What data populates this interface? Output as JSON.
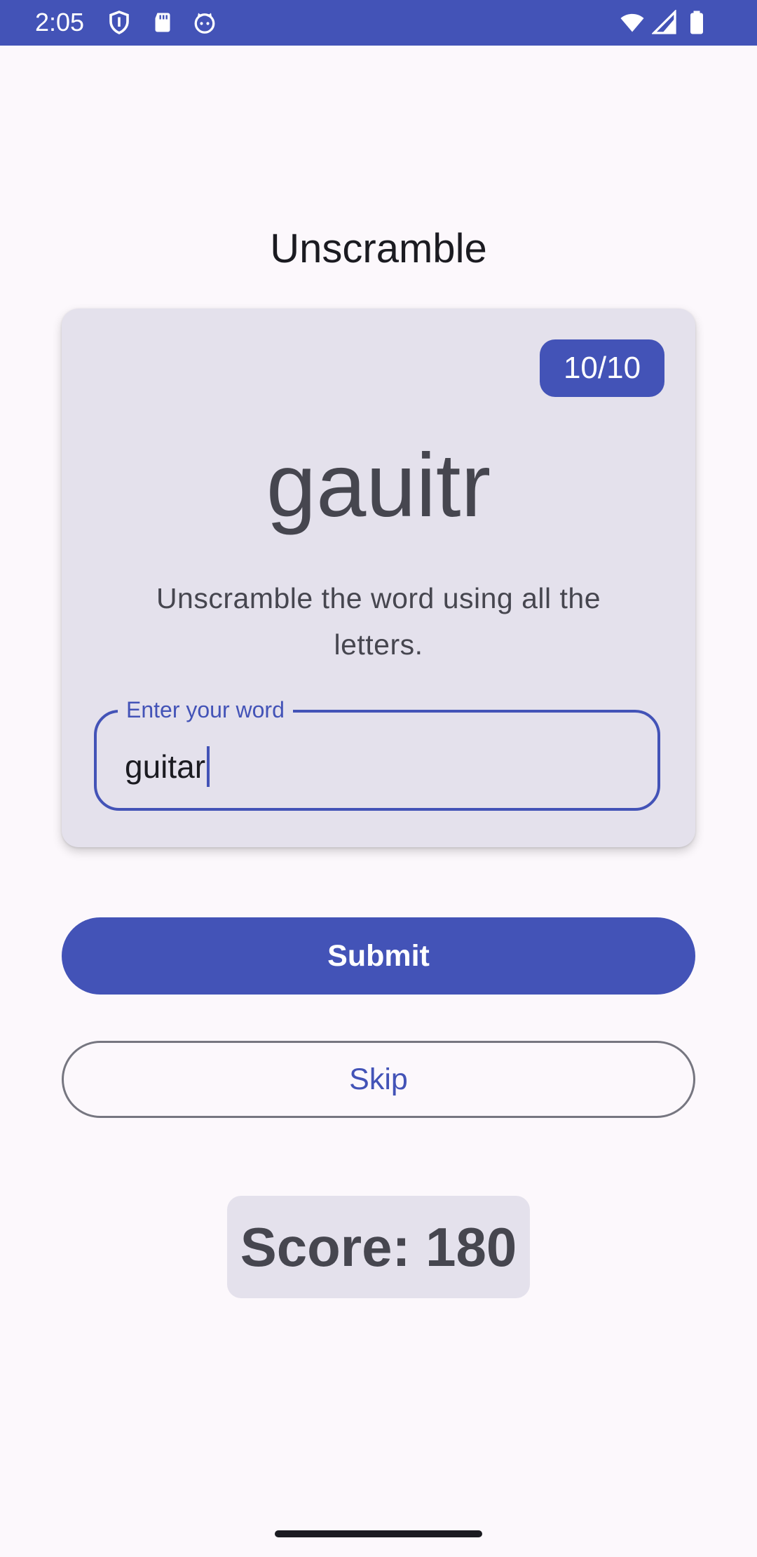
{
  "status_bar": {
    "time": "2:05",
    "background_color": "#4353B7",
    "icons_left": [
      "shield-icon",
      "sd-card-icon",
      "cat-face-icon"
    ],
    "icons_right": [
      "wifi-icon",
      "cell-signal-icon",
      "battery-icon"
    ]
  },
  "app": {
    "title": "Unscramble"
  },
  "card": {
    "word_count": "10/10",
    "scrambled_word": "gauitr",
    "instructions": "Unscramble the word using all the letters.",
    "input": {
      "label": "Enter your word",
      "value": "guitar"
    }
  },
  "buttons": {
    "submit_label": "Submit",
    "skip_label": "Skip"
  },
  "score": {
    "text": "Score: 180"
  },
  "colors": {
    "primary": "#4353B7",
    "background": "#FCF8FC",
    "card": "#E4E1EC",
    "on_surface_variant": "#46464F"
  }
}
